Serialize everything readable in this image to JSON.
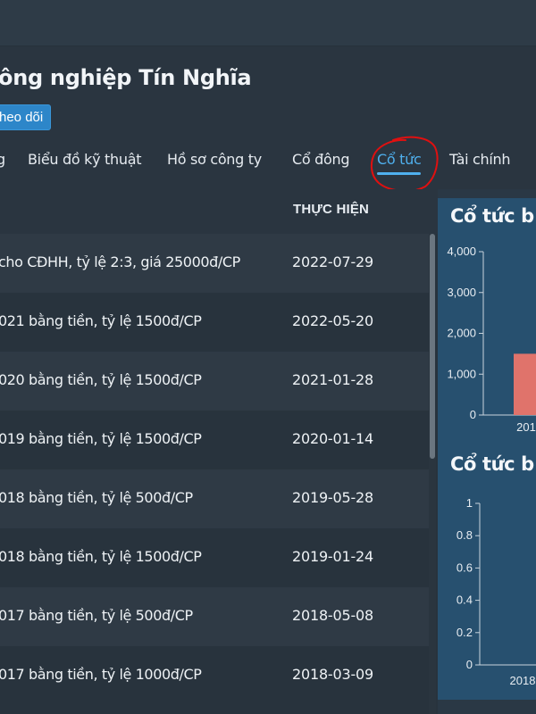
{
  "company": {
    "title": "ông nghiệp Tín Nghĩa",
    "follow_label": "heo dõi"
  },
  "tabs": [
    {
      "label": "g",
      "active": false
    },
    {
      "label": "Biểu đồ kỹ thuật",
      "active": false
    },
    {
      "label": "Hồ sơ công ty",
      "active": false
    },
    {
      "label": "Cổ đông",
      "active": false
    },
    {
      "label": "Cổ tức",
      "active": true
    },
    {
      "label": "Tài chính",
      "active": false
    }
  ],
  "table": {
    "date_header": "THỰC HIỆN",
    "rows": [
      {
        "description": "cho CĐHH, tỷ lệ 2:3, giá 25000đ/CP",
        "date": "2022-07-29"
      },
      {
        "description": "021 bằng tiền, tỷ lệ 1500đ/CP",
        "date": "2022-05-20"
      },
      {
        "description": "020 bằng tiền, tỷ lệ 1500đ/CP",
        "date": "2021-01-28"
      },
      {
        "description": "019 bằng tiền, tỷ lệ 1500đ/CP",
        "date": "2020-01-14"
      },
      {
        "description": "018 bằng tiền, tỷ lệ 500đ/CP",
        "date": "2019-05-28"
      },
      {
        "description": "018 bằng tiền, tỷ lệ 1500đ/CP",
        "date": "2019-01-24"
      },
      {
        "description": "017 bằng tiền, tỷ lệ 500đ/CP",
        "date": "2018-05-08"
      },
      {
        "description": "017 bằng tiền, tỷ lệ 1000đ/CP",
        "date": "2018-03-09"
      }
    ]
  },
  "colors": {
    "accent": "#4fb0ee",
    "bar": "#e0736b",
    "annotation": "#e01010",
    "chart_bg": "#27506f"
  },
  "chart_data": [
    {
      "type": "bar",
      "title": "Cổ tức b",
      "categories": [
        "201"
      ],
      "values": [
        1500
      ],
      "ylim": [
        0,
        4000
      ],
      "yticks": [
        "0",
        "1,000",
        "2,000",
        "3,000",
        "4,000"
      ],
      "xlabel": "",
      "ylabel": ""
    },
    {
      "type": "bar",
      "title": "Cổ tức b",
      "categories": [
        "2018"
      ],
      "values": [],
      "ylim": [
        0,
        1
      ],
      "yticks": [
        "0",
        "0.2",
        "0.4",
        "0.6",
        "0.8",
        "1"
      ],
      "xlabel": "",
      "ylabel": ""
    }
  ]
}
